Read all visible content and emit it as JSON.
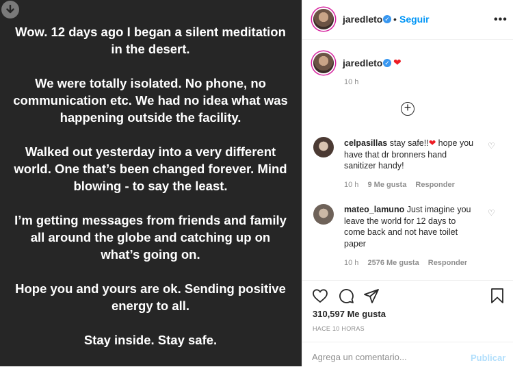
{
  "post": {
    "paragraphs": [
      "Wow. 12 days ago I began a silent meditation in the desert.",
      "We were totally isolated. No phone, no communication etc. We had no idea what was happening outside the facility.",
      "Walked out yesterday into a very different world. One that’s been changed forever. Mind blowing - to say the least.",
      "I’m getting messages from friends and family all around the globe and catching up on what’s going on.",
      "Hope you and yours are ok. Sending positive energy to all.",
      "Stay inside. Stay safe."
    ]
  },
  "header": {
    "username": "jaredleto",
    "dot": "•",
    "follow_label": "Seguir",
    "more_label": "•••"
  },
  "caption": {
    "username": "jaredleto",
    "emoji": "❤",
    "time": "10 h"
  },
  "comments": [
    {
      "username": "celpasillas",
      "text_before": "stay safe!!",
      "emoji": "❤",
      "text_after": " hope you have that dr bronners hand sanitizer handy!",
      "time": "10 h",
      "likes": "9 Me gusta",
      "reply": "Responder"
    },
    {
      "username": "mateo_lamuno",
      "text": "Just imagine you leave the world for 12 days to come back and not have toilet paper",
      "time": "10 h",
      "likes": "2576 Me gusta",
      "reply": "Responder"
    }
  ],
  "stats": {
    "likes": "310,597 Me gusta",
    "ago": "HACE 10 HORAS"
  },
  "composer": {
    "placeholder": "Agrega un comentario...",
    "publish_label": "Publicar"
  },
  "icons": {
    "download": "download-icon",
    "like": "heart-icon",
    "comment": "comment-icon",
    "share": "send-icon",
    "save": "bookmark-icon",
    "load_more": "plus-circle-icon",
    "verified": "verified-badge-icon"
  },
  "colors": {
    "accent": "#0095f6",
    "verified": "#3897f0",
    "publish_disabled": "#b2dffc",
    "post_background": "#262626"
  }
}
